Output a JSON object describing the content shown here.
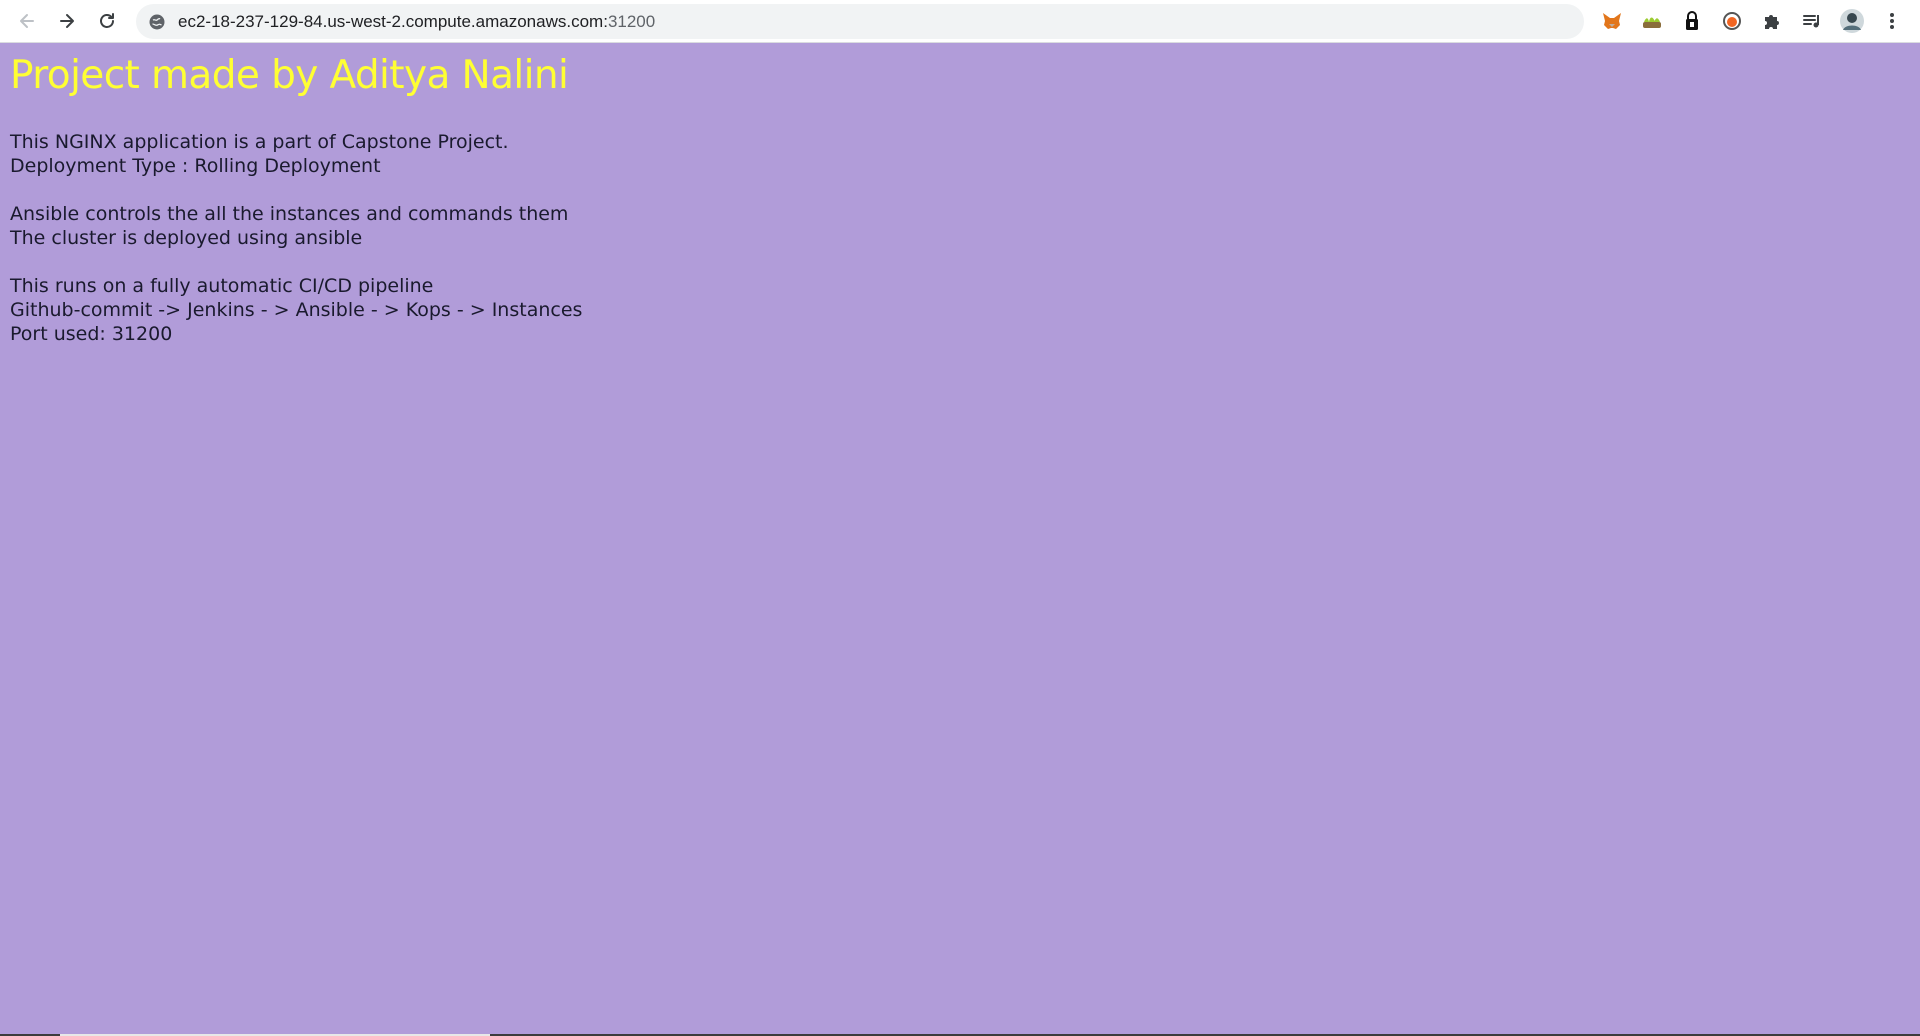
{
  "browser": {
    "url_host": "ec2-18-237-129-84.us-west-2.compute.amazonaws.com:",
    "url_port": "31200",
    "nav": {
      "back_icon": "arrow-left-icon",
      "forward_icon": "arrow-right-icon",
      "reload_icon": "reload-icon"
    },
    "extensions": [
      "fox-extension-icon",
      "grass-extension-icon",
      "lock-extension-icon",
      "orange-circle-extension-icon",
      "puzzle-icon",
      "media-queue-icon",
      "profile-avatar-icon",
      "kebab-menu-icon"
    ]
  },
  "page": {
    "background_color": "#b19cd9",
    "title_color": "#ffff33",
    "title": "Project made by Aditya Nalini",
    "block1": {
      "line1": "This NGINX application is a part of Capstone Project.",
      "line2": "Deployment Type : Rolling Deployment"
    },
    "block2": {
      "line1": "Ansible controls the all the instances and commands them",
      "line2": "The cluster is deployed using ansible"
    },
    "block3": {
      "line1": "This runs on a fully automatic CI/CD pipeline",
      "line2": "Github-commit -> Jenkins - > Ansible - > Kops - > Instances",
      "line3": "Port used: 31200"
    }
  }
}
